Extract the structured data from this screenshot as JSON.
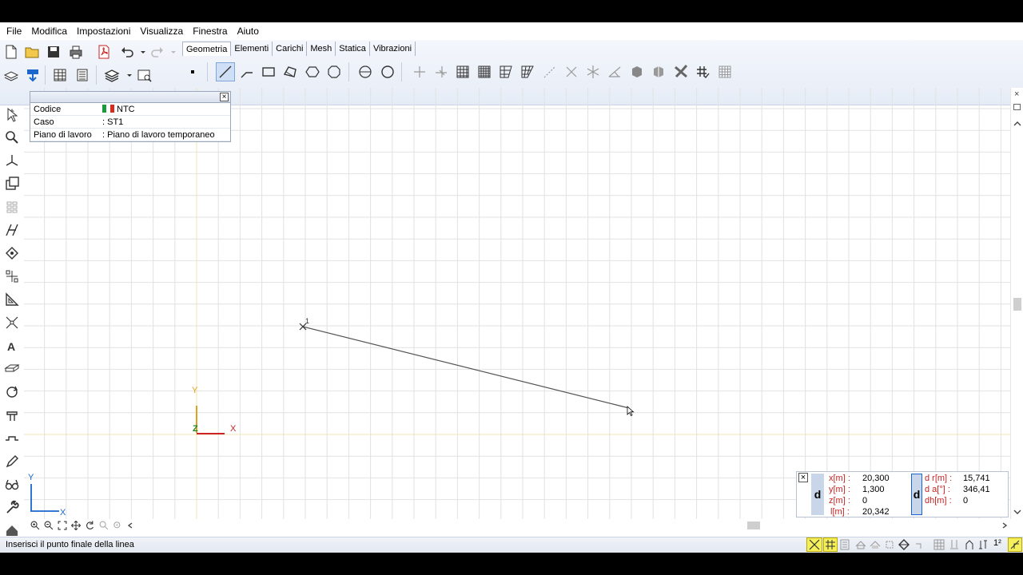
{
  "menu": [
    "File",
    "Modifica",
    "Impostazioni",
    "Visualizza",
    "Finestra",
    "Aiuto"
  ],
  "tabs": [
    "Geometria",
    "Elementi",
    "Carichi",
    "Mesh",
    "Statica",
    "Vibrazioni"
  ],
  "active_tab": "Geometria",
  "infobox": {
    "rows": [
      {
        "key": "Codice",
        "value": "NTC"
      },
      {
        "key": "Caso",
        "value": ": ST1"
      },
      {
        "key": "Piano di lavoro",
        "value": ": Piano di lavoro temporaneo"
      }
    ]
  },
  "canvas": {
    "point_label": "1",
    "axes": {
      "y": "Y",
      "x": "X",
      "z": "Z"
    },
    "mini_axes": {
      "y": "Y",
      "x": "X"
    }
  },
  "coords_left": {
    "badge": "d",
    "x_label": "x[m] :",
    "x_value": "20,300",
    "y_label": "y[m] :",
    "y_value": "1,300",
    "z_label": "z[m] :",
    "z_value": "0",
    "l_label": "l[m] :",
    "l_value": "20,342"
  },
  "coords_right": {
    "badge": "d",
    "dr_label": "d r[m] :",
    "dr_value": "15,741",
    "da_label": "d a[°] :",
    "da_value": "346,41",
    "dh_label": "dh[m] :",
    "dh_value": "0"
  },
  "status": {
    "message": "Inserisci il punto finale della linea"
  },
  "colors": {
    "grid": "#e2e2e2",
    "line": "#555555",
    "axis_y": "#e0a020",
    "axis_x": "#cc2222",
    "axis_z": "#228822",
    "mini_axis": "#1a66cc"
  }
}
